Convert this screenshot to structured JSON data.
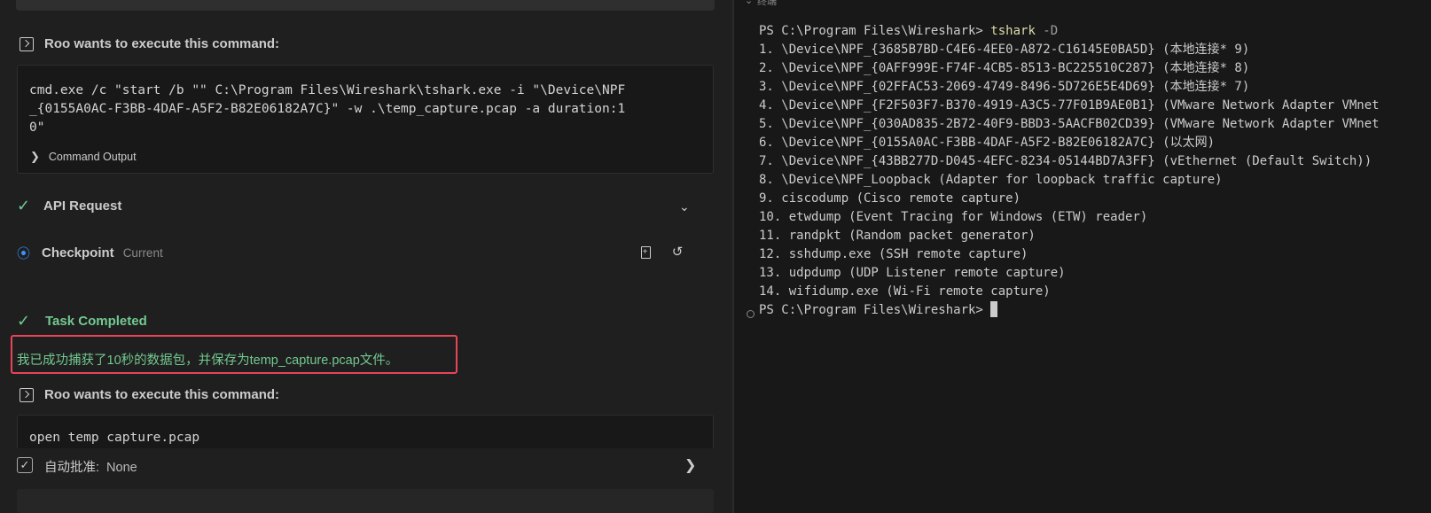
{
  "left_panel": {
    "command_block_1": {
      "header": "Roo wants to execute this command:",
      "command_lines": [
        "cmd.exe /c \"start /b \"\" C:\\Program Files\\Wireshark\\tshark.exe -i \"\\Device\\NPF",
        "_{0155A0AC-F3BB-4DAF-A5F2-B82E06182A7C}\" -w .\\temp_capture.pcap -a duration:1",
        "0\""
      ],
      "output_toggle": "Command Output"
    },
    "api_request": {
      "label": "API Request"
    },
    "checkpoint": {
      "label": "Checkpoint",
      "status": "Current"
    },
    "task_completed": {
      "label": "Task Completed",
      "result": "我已成功捕获了10秒的数据包，并保存为temp_capture.pcap文件。"
    },
    "command_block_2": {
      "header": "Roo wants to execute this command:",
      "command": "open temp capture.pcap"
    },
    "auto_approve": {
      "label": "自动批准:",
      "value": "None"
    }
  },
  "terminal": {
    "tab_label": "终端",
    "prompt_1": "PS C:\\Program Files\\Wireshark> ",
    "command": "tshark",
    "flag": " -D",
    "lines": [
      "1. \\Device\\NPF_{3685B7BD-C4E6-4EE0-A872-C16145E0BA5D} (本地连接* 9)",
      "2. \\Device\\NPF_{0AFF999E-F74F-4CB5-8513-BC225510C287} (本地连接* 8)",
      "3. \\Device\\NPF_{02FFAC53-2069-4749-8496-5D726E5E4D69} (本地连接* 7)",
      "4. \\Device\\NPF_{F2F503F7-B370-4919-A3C5-77F01B9AE0B1} (VMware Network Adapter VMnet",
      "5. \\Device\\NPF_{030AD835-2B72-40F9-BBD3-5AACFB02CD39} (VMware Network Adapter VMnet",
      "6. \\Device\\NPF_{0155A0AC-F3BB-4DAF-A5F2-B82E06182A7C} (以太网)",
      "7. \\Device\\NPF_{43BB277D-D045-4EFC-8234-05144BD7A3FF} (vEthernet (Default Switch))",
      "8. \\Device\\NPF_Loopback (Adapter for loopback traffic capture)",
      "9. ciscodump (Cisco remote capture)",
      "10. etwdump (Event Tracing for Windows (ETW) reader)",
      "11. randpkt (Random packet generator)",
      "12. sshdump.exe (SSH remote capture)",
      "13. udpdump (UDP Listener remote capture)",
      "14. wifidump.exe (Wi-Fi remote capture)"
    ],
    "prompt_2": "PS C:\\Program Files\\Wireshark>"
  },
  "colors": {
    "success_green": "#73c991",
    "highlight_red": "#e9445a",
    "checkpoint_blue": "#3794ff",
    "command_yellow": "#dcdcaa"
  }
}
